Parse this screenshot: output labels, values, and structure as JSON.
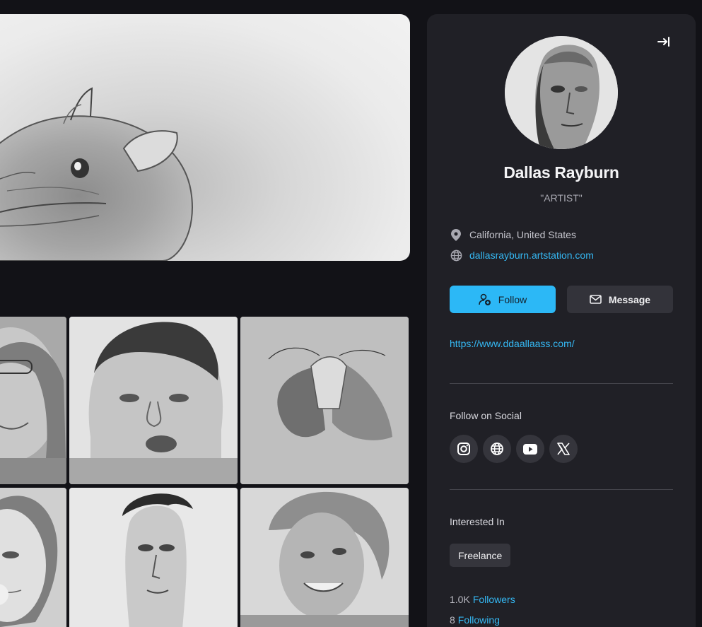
{
  "profile": {
    "name": "Dallas Rayburn",
    "role": "\"ARTIST\"",
    "location": "California, United States",
    "artstation_url": "dallasrayburn.artstation.com",
    "website": "https://www.ddaallaass.com/"
  },
  "actions": {
    "follow_label": "Follow",
    "message_label": "Message"
  },
  "social": {
    "heading": "Follow on Social",
    "icons": [
      "instagram-icon",
      "globe-icon",
      "youtube-icon",
      "x-icon"
    ]
  },
  "interests": {
    "heading": "Interested In",
    "items": [
      "Freelance"
    ]
  },
  "stats": {
    "followers_count": "1.0K",
    "followers_label": "Followers",
    "following_count": "8",
    "following_label": "Following"
  },
  "colors": {
    "accent": "#2cb8f6",
    "link": "#35b8f3",
    "panel": "#202026",
    "background": "#121217"
  }
}
